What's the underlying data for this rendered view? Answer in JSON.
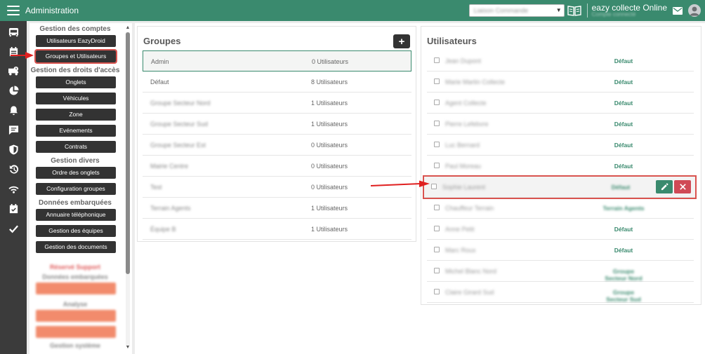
{
  "header": {
    "title": "Administration",
    "select_value": "Liaison Commande",
    "app_name": "eazy collecte Online",
    "app_sub": "Compte connecté"
  },
  "rail": {
    "icons": [
      "bus-icon",
      "calendar-icon",
      "truck-clock-icon",
      "pie-chart-icon",
      "alarm-bell-icon",
      "message-icon",
      "shield-icon",
      "history-icon",
      "signal-icon",
      "calendar-check-icon",
      "check-icon"
    ]
  },
  "menu": {
    "section_accounts": "Gestion des comptes",
    "btn_users_eazydroid": "Utilisateurs EazyDroid",
    "btn_groups_users": "Groupes et Utilisateurs",
    "section_access": "Gestion des droits d'accès",
    "btn_tabs": "Onglets",
    "btn_vehicles": "Véhicules",
    "btn_zone": "Zone",
    "btn_events": "Evénements",
    "btn_contracts": "Contrats",
    "section_misc": "Gestion divers",
    "btn_tab_order": "Ordre des onglets",
    "btn_group_config": "Configuration groupes",
    "section_embedded": "Données embarquées",
    "btn_phonebook": "Annuaire téléphonique",
    "btn_teams": "Gestion des équipes",
    "btn_documents": "Gestion des documents",
    "reserved_title": "Réservé Support",
    "reserved_sub1": "Données embarquées",
    "reserved_sub2": "Analyse",
    "reserved_sub3": "Gestion système"
  },
  "groups": {
    "title": "Groupes",
    "add_label": "+",
    "rows": [
      {
        "name": "Admin",
        "count": "0 Utilisateurs"
      },
      {
        "name": "Défaut",
        "count": "8 Utilisateurs"
      },
      {
        "name": "Groupe Secteur Nord",
        "count": "1 Utilisateurs"
      },
      {
        "name": "Groupe Secteur Sud",
        "count": "1 Utilisateurs"
      },
      {
        "name": "Groupe Secteur Est",
        "count": "0 Utilisateurs"
      },
      {
        "name": "Mairie Centre",
        "count": "0 Utilisateurs"
      },
      {
        "name": "Test",
        "count": "0 Utilisateurs"
      },
      {
        "name": "Terrain Agents",
        "count": "1 Utilisateurs"
      },
      {
        "name": "Équipe B",
        "count": "1 Utilisateurs"
      }
    ]
  },
  "users": {
    "title": "Utilisateurs",
    "rows": [
      {
        "name": "Jean Dupont",
        "group": "Défaut"
      },
      {
        "name": "Marie Martin Collecte",
        "group": "Défaut"
      },
      {
        "name": "Agent Collecte",
        "group": "Défaut"
      },
      {
        "name": "Pierre Lefebvre",
        "group": "Défaut"
      },
      {
        "name": "Luc Bernard",
        "group": "Défaut"
      },
      {
        "name": "Paul Moreau",
        "group": "Défaut"
      },
      {
        "name": "Sophie Laurent",
        "group": "Défaut"
      },
      {
        "name": "Chauffeur Terrain",
        "group": "Terrain Agents"
      },
      {
        "name": "Anne Petit",
        "group": "Défaut"
      },
      {
        "name": "Marc Roux",
        "group": "Défaut"
      },
      {
        "name": "Michel Blanc Nord",
        "group": "Groupe Secteur Nord"
      },
      {
        "name": "Claire Girard Sud",
        "group": "Groupe Secteur Sud"
      }
    ]
  },
  "colors": {
    "topbar": "#3a8a6e",
    "rail": "#3b3b3b",
    "accent_green": "#3a8a6e",
    "danger_red": "#d9534f"
  }
}
